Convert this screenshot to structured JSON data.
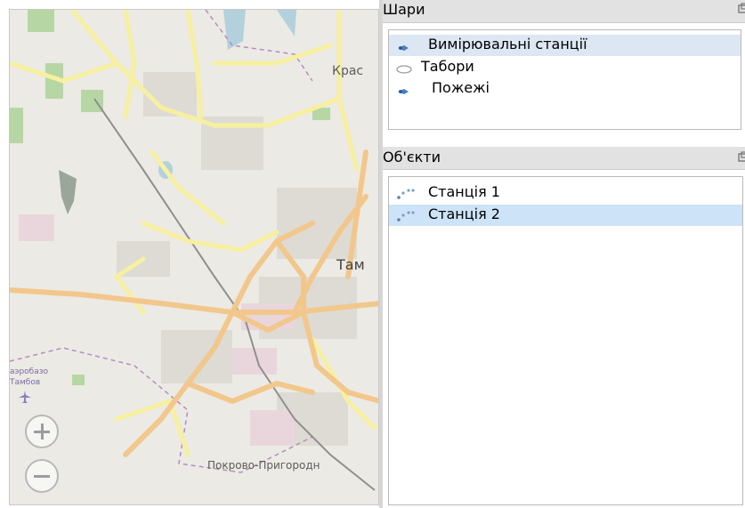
{
  "map": {
    "labels": {
      "krasnyi": "Крас",
      "tambov": "Там",
      "airport_line1": "аэробазо",
      "airport_line2": "Тамбов",
      "pokrovo": "Покрово-Пригородн"
    },
    "zoom_in_icon": "plus-icon",
    "zoom_out_icon": "minus-icon"
  },
  "layers": {
    "title": "Шари",
    "float_icon": "float-icon",
    "items": [
      {
        "label": "Вимірювальні станції",
        "icon": "point-layer-icon",
        "selected": true
      },
      {
        "label": "Табори",
        "icon": "polygon-layer-icon",
        "selected": false
      },
      {
        "label": "Пожежі",
        "icon": "point-layer-icon",
        "selected": false
      }
    ]
  },
  "objects": {
    "title": "Об'єкти",
    "float_icon": "float-icon",
    "items": [
      {
        "label": "Станція 1",
        "icon": "points-icon",
        "selected": false
      },
      {
        "label": "Станція 2",
        "icon": "points-icon",
        "selected": true
      }
    ]
  },
  "colors": {
    "major_road": "#f2c78c",
    "secondary_road": "#f6f0a0",
    "park": "#b6d7a3",
    "selection": "#cde3f7"
  }
}
